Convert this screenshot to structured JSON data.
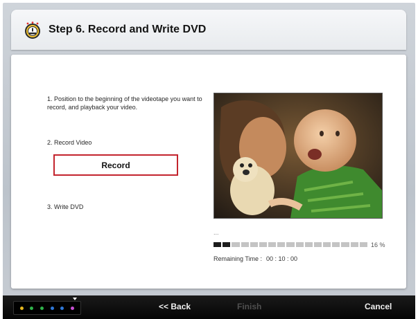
{
  "header": {
    "title": "Step 6. Record and Write DVD",
    "icon": "alarm-clock-icon"
  },
  "steps": {
    "step1": "1. Position to the beginning of the videotape you want to record, and playback your video.",
    "step2": "2. Record Video",
    "step3": "3. Write DVD"
  },
  "record_button": {
    "label": "Record",
    "border_color": "#c3242d"
  },
  "preview": {
    "image": "baby-and-father-photo-icon"
  },
  "progress": {
    "dots": "...",
    "percent_value": 16,
    "percent_label": "16 %",
    "remaining_label": "Remaining Time :",
    "remaining_value": "00 : 10 : 00"
  },
  "footer": {
    "back": "<< Back",
    "finish": "Finish",
    "cancel": "Cancel",
    "led_colors": [
      "#e5b81f",
      "#2fb34a",
      "#2fb34a",
      "#2f78d8",
      "#2f78d8",
      "#c94fd4"
    ]
  }
}
